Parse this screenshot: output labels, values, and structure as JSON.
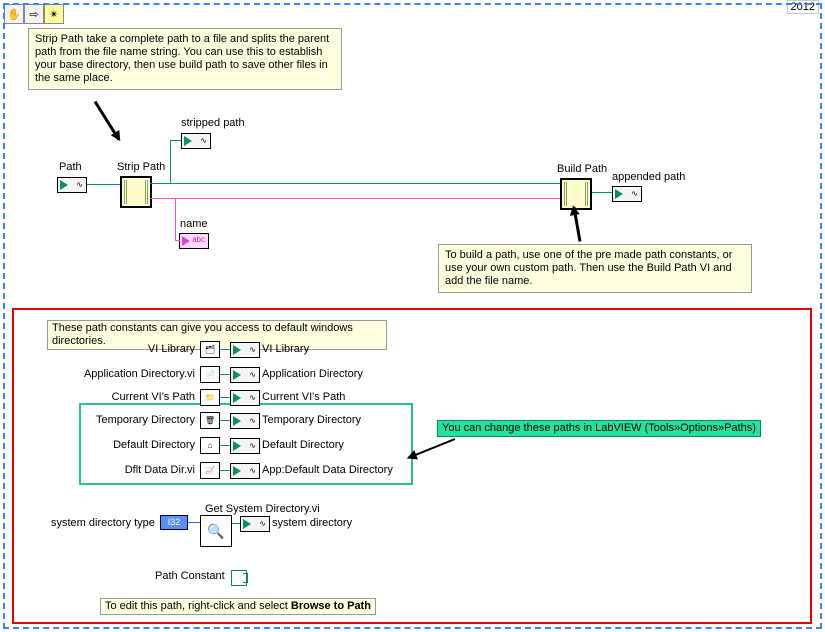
{
  "toolbar": {
    "year": "2012"
  },
  "comments": {
    "strip": "Strip Path take a complete path to a file and splits the parent path from the file name string. You can use this to establish your base directory, then use build path to save other files in the same place.",
    "build": "To build a path, use one of the pre made path constants, or use your own custom path. Then use the Build Path VI and add the file name.",
    "constants": "These path constants can give you access to default windows directories.",
    "change": "You can change these paths in LabVIEW (Tools»Options»Paths)",
    "edit_help": "To edit this path, right-click and select Browse to Path"
  },
  "labels": {
    "path_in": "Path",
    "strip_node": "Strip Path",
    "stripped": "stripped path",
    "name": "name",
    "build_node": "Build Path",
    "appended": "appended path",
    "int_terminal": "I32"
  },
  "constants": {
    "rows": [
      {
        "left_label": "VI Library",
        "out_label": "VI Library"
      },
      {
        "left_label": "Application Directory.vi",
        "out_label": "Application Directory"
      },
      {
        "left_label": "Current VI's Path",
        "out_label": "Current VI's Path"
      },
      {
        "left_label": "Temporary Directory",
        "out_label": "Temporary Directory"
      },
      {
        "left_label": "Default Directory",
        "out_label": "Default Directory"
      },
      {
        "left_label": "Dflt Data Dir.vi",
        "out_label": "App:Default Data Directory"
      }
    ],
    "sysdir": {
      "type_label": "system directory type",
      "title": "Get System Directory.vi",
      "out_label": "system directory"
    },
    "path_constant_label": "Path Constant"
  }
}
